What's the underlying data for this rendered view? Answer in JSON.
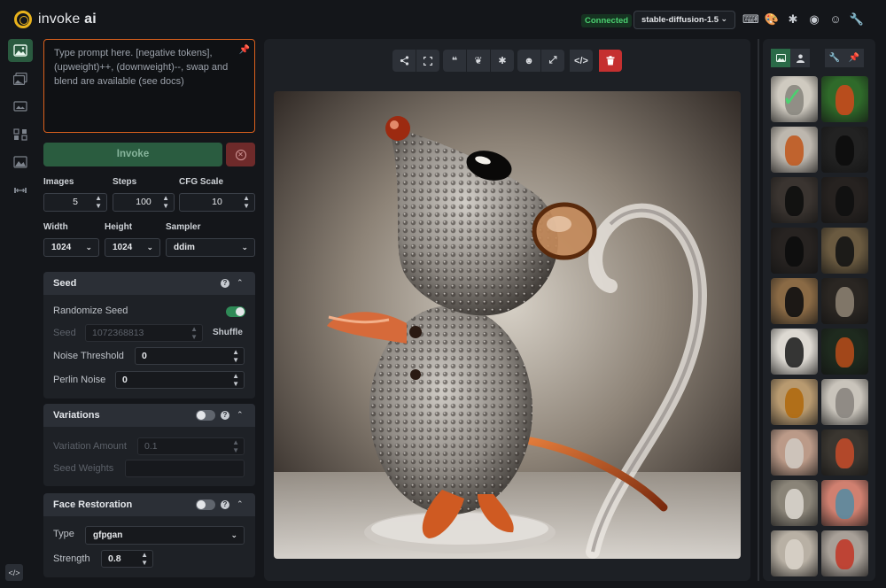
{
  "header": {
    "logo_word": "invoke",
    "logo_ai": "ai",
    "status": "Connected",
    "model": "stable-diffusion-1.5",
    "icons": [
      "keyboard-icon",
      "palette-icon",
      "bug-icon",
      "github-icon",
      "discord-icon",
      "wrench-icon"
    ]
  },
  "rail": {
    "items": [
      "text-to-image-icon",
      "image-to-image-icon",
      "inpainting-icon",
      "nodes-icon",
      "outpainting-icon",
      "training-icon"
    ],
    "active_index": 0
  },
  "prompt": {
    "placeholder": "Type prompt here. [negative tokens], (upweight)++, (downweight)--, swap and blend are available (see docs)"
  },
  "invoke": {
    "label": "Invoke"
  },
  "params": {
    "images_label": "Images",
    "images": "5",
    "steps_label": "Steps",
    "steps": "100",
    "cfg_label": "CFG Scale",
    "cfg": "10",
    "width_label": "Width",
    "width": "1024",
    "height_label": "Height",
    "height": "1024",
    "sampler_label": "Sampler",
    "sampler": "ddim"
  },
  "seed": {
    "title": "Seed",
    "help": "?",
    "randomize_label": "Randomize Seed",
    "randomize_on": true,
    "seed_label": "Seed",
    "seed_value": "1072368813",
    "shuffle_label": "Shuffle",
    "noise_label": "Noise Threshold",
    "noise_value": "0",
    "perlin_label": "Perlin Noise",
    "perlin_value": "0"
  },
  "variations": {
    "title": "Variations",
    "help": "?",
    "enabled": false,
    "amount_label": "Variation Amount",
    "amount_value": "0.1",
    "weights_label": "Seed Weights"
  },
  "face_restoration": {
    "title": "Face Restoration",
    "help": "?",
    "enabled": false,
    "type_label": "Type",
    "type_value": "gfpgan",
    "strength_label": "Strength",
    "strength_value": "0.8"
  },
  "toolbar": {
    "groups": [
      [
        "share-icon",
        "fullscreen-icon"
      ],
      [
        "quote-icon",
        "seedling-icon",
        "asterisk-icon"
      ],
      [
        "face-icon",
        "expand-icon"
      ],
      [
        "code-icon"
      ],
      [
        "trash-icon"
      ]
    ]
  },
  "gallery": {
    "tabs": [
      "images-tab",
      "user-tab"
    ],
    "settings": [
      "wrench-icon",
      "pin-icon"
    ],
    "thumbnails": [
      {
        "subject": "glass mouse (selected)",
        "bg": "#cfcac0",
        "fg": "#8a8780"
      },
      {
        "subject": "glass frog",
        "bg": "#2f6a2a",
        "fg": "#c84a1c"
      },
      {
        "subject": "glass mouse",
        "bg": "#bdb7ae",
        "fg": "#c05a20"
      },
      {
        "subject": "black rabbit",
        "bg": "#222",
        "fg": "#0c0c0c"
      },
      {
        "subject": "black rabbit",
        "bg": "#3a3430",
        "fg": "#0e0e0e"
      },
      {
        "subject": "black rabbit",
        "bg": "#262220",
        "fg": "#101010"
      },
      {
        "subject": "black rabbit",
        "bg": "#272321",
        "fg": "#0c0c0c"
      },
      {
        "subject": "black rabbit",
        "bg": "#6a5a40",
        "fg": "#141414"
      },
      {
        "subject": "black rabbit",
        "bg": "#8a6a45",
        "fg": "#101010"
      },
      {
        "subject": "glass rabbit",
        "bg": "#2a2622",
        "fg": "#8a8070"
      },
      {
        "subject": "dotted rabbit",
        "bg": "#ddd9d2",
        "fg": "#222"
      },
      {
        "subject": "glass mouse",
        "bg": "#1e2a1e",
        "fg": "#b04a1a"
      },
      {
        "subject": "amber mouse",
        "bg": "#b89a70",
        "fg": "#b06a10"
      },
      {
        "subject": "glass mouse",
        "bg": "#c9c4bb",
        "fg": "#8a8580"
      },
      {
        "subject": "glass mouse in hand",
        "bg": "#bb9a88",
        "fg": "#cfc8c0"
      },
      {
        "subject": "colorful mouse",
        "bg": "#3a3630",
        "fg": "#c04a2a"
      },
      {
        "subject": "glass mouse",
        "bg": "#8a8478",
        "fg": "#d8d4cc"
      },
      {
        "subject": "glass mouse",
        "bg": "#d08070",
        "fg": "#5a8aa0"
      },
      {
        "subject": "glass mouse",
        "bg": "#b8b0a4",
        "fg": "#d8d2c8"
      },
      {
        "subject": "glass mouse",
        "bg": "#a8a098",
        "fg": "#c03a2a"
      }
    ]
  },
  "colors": {
    "accent": "#2a5a3f",
    "prompt_border": "#d9601d",
    "danger": "#c53030",
    "connected": "#4bd070"
  }
}
